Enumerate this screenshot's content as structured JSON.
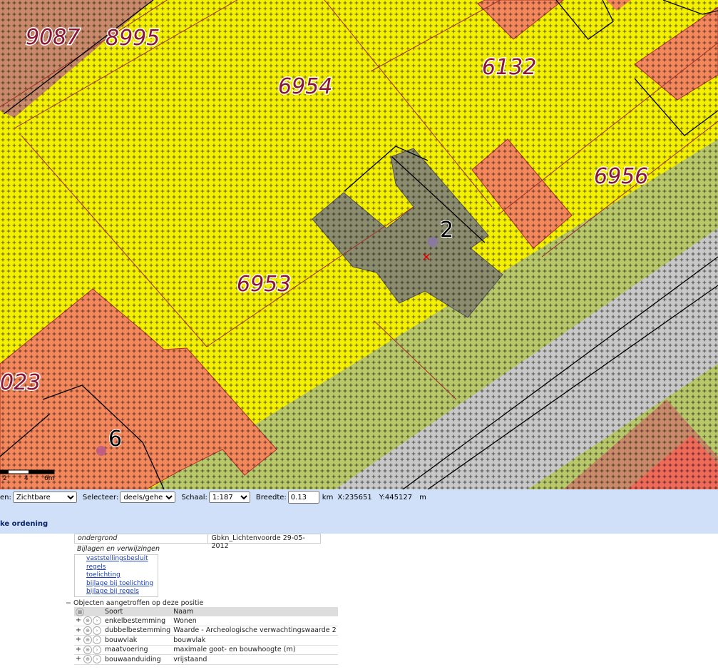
{
  "map": {
    "plot_numbers": [
      "9087",
      "8995",
      "6954",
      "6132",
      "6956",
      "6953",
      "023"
    ],
    "house_numbers": [
      "2",
      "6"
    ],
    "scale_ticks": [
      "2",
      "4",
      "6m"
    ],
    "colors": {
      "wonen": "#f5f000",
      "bouwvlak": "#f4875c",
      "groen": "#b9c86a",
      "verkeer": "#c8c8c8",
      "aanduiding": "#8c8c6e"
    }
  },
  "toolbar": {
    "lagen_label": "en:",
    "lagen_value": "Zichtbare",
    "selecteer_label": "Selecteer:",
    "selecteer_value": "deels/geheel",
    "schaal_label": "Schaal:",
    "schaal_value": "1:187",
    "breedte_label": "Breedte:",
    "breedte_value": "0.13",
    "breedte_unit": "km",
    "x_label": "X:",
    "x_value": "235651",
    "y_label": "Y:",
    "y_value": "445127",
    "xy_unit": "m",
    "sort_link": "ke ordening"
  },
  "info": {
    "ondergrond_key": "ondergrond",
    "ondergrond_value": "Gbkn_Lichtenvoorde 29-05-2012",
    "attachments_title": "Bijlagen en verwijzingen",
    "attachments": [
      "vaststellingsbesluit",
      "regels",
      "toelichting",
      "bijlage bij toelichting",
      "bijlage bij regels"
    ],
    "objects_title": "Objecten aangetroffen op deze positie",
    "columns": [
      "Soort",
      "Naam"
    ],
    "rows": [
      {
        "soort": "enkelbestemming",
        "naam": "Wonen"
      },
      {
        "soort": "dubbelbestemming",
        "naam": "Waarde - Archeologische verwachtingswaarde 2"
      },
      {
        "soort": "bouwvlak",
        "naam": "bouwvlak"
      },
      {
        "soort": "maatvoering",
        "naam": "maximale goot- en bouwhoogte (m)"
      },
      {
        "soort": "bouwaanduiding",
        "naam": "vrijstaand"
      }
    ]
  }
}
